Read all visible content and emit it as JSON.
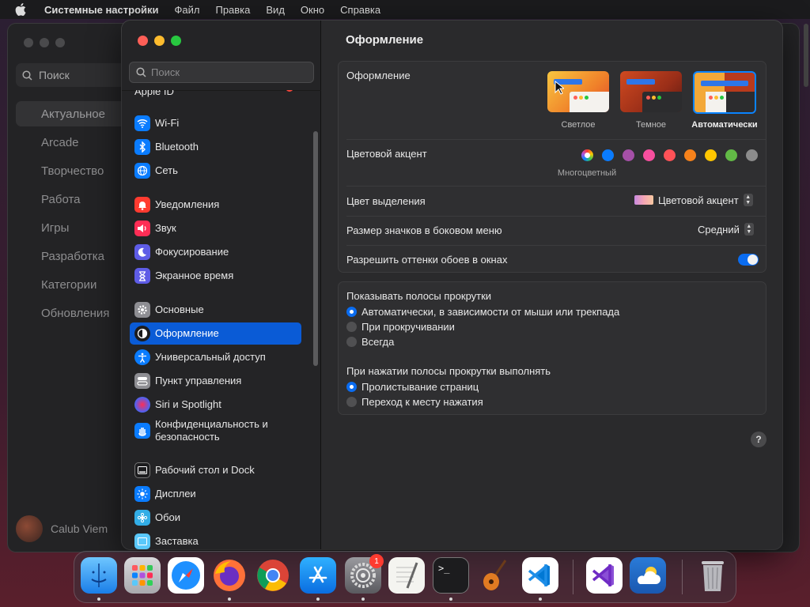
{
  "menubar": {
    "app": "Системные настройки",
    "items": [
      "Файл",
      "Правка",
      "Вид",
      "Окно",
      "Справка"
    ]
  },
  "bg_window": {
    "search_placeholder": "Поиск",
    "categories": [
      "Актуальное",
      "Arcade",
      "Творчество",
      "Работа",
      "Игры",
      "Разработка",
      "Категории",
      "Обновления"
    ],
    "user_name": "Calub Viem"
  },
  "sidebar": {
    "search_placeholder": "Поиск",
    "items": [
      {
        "label": "Apple ID"
      },
      {
        "label": "Wi‑Fi"
      },
      {
        "label": "Bluetooth"
      },
      {
        "label": "Сеть"
      },
      {
        "label": "Уведомления"
      },
      {
        "label": "Звук"
      },
      {
        "label": "Фокусирование"
      },
      {
        "label": "Экранное время"
      },
      {
        "label": "Основные"
      },
      {
        "label": "Оформление"
      },
      {
        "label": "Универсальный доступ"
      },
      {
        "label": "Пункт управления"
      },
      {
        "label": "Siri и Spotlight"
      },
      {
        "label": "Конфиденциальность и безопасность"
      },
      {
        "label": "Рабочий стол и Dock"
      },
      {
        "label": "Дисплеи"
      },
      {
        "label": "Обои"
      },
      {
        "label": "Заставка"
      }
    ]
  },
  "main": {
    "title": "Оформление",
    "appearance": {
      "label": "Оформление",
      "options": [
        "Светлое",
        "Темное",
        "Автоматически"
      ],
      "selected": "Автоматически"
    },
    "accent": {
      "label": "Цветовой акцент",
      "selected_caption": "Многоцветный"
    },
    "highlight": {
      "label": "Цвет выделения",
      "value": "Цветовой акцент"
    },
    "icon_size": {
      "label": "Размер значков в боковом меню",
      "value": "Средний"
    },
    "tinting": {
      "label": "Разрешить оттенки обоев в окнах",
      "enabled": true
    },
    "scrollbars": {
      "label": "Показывать полосы прокрутки",
      "options": [
        "Автоматически, в зависимости от мыши или трекпада",
        "При прокручивании",
        "Всегда"
      ],
      "selected": 0
    },
    "click": {
      "label": "При нажатии полосы прокрутки выполнять",
      "options": [
        "Пролистывание страниц",
        "Переход к месту нажатия"
      ],
      "selected": 0
    },
    "help": "?"
  },
  "dock": {
    "badge_settings": "1"
  },
  "colors": {
    "accent": "#0a6cf0",
    "selection": "#0a5bd6"
  }
}
